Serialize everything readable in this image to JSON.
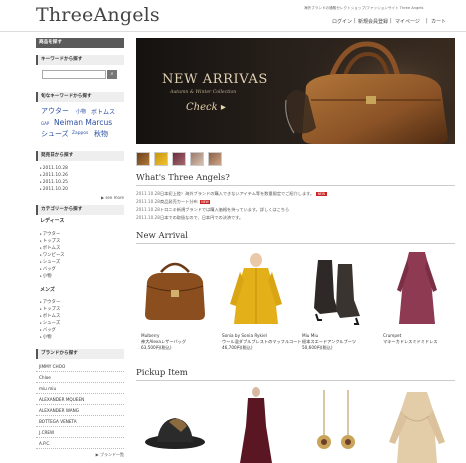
{
  "header": {
    "logo": "ThreeAngels",
    "tagline": "海外ブランドの通販セレクトショップ/ファッションサイト Three Angels",
    "nav": [
      "ログイン",
      "新規会員登録",
      "マイページ",
      "カート"
    ]
  },
  "sidebar": {
    "product_search_label": "商品を探す",
    "keyword_search_label": "キーワードから探す",
    "popular_keywords_label": "旬なキーワードから探す",
    "keywords": [
      "アウター",
      "小物",
      "ボトムス",
      "GAP",
      "Neiman Marcus",
      "シューズ",
      "Zappos",
      "秋物"
    ],
    "release_date_label": "発売日から探す",
    "release_dates": [
      "2011.10.28",
      "2011.10.26",
      "2011.10.25",
      "2011.10.20"
    ],
    "see_more": "▶ see more",
    "category_label": "カテゴリーから探す",
    "ladies_label": "レディース",
    "ladies_items": [
      "アウター",
      "トップス",
      "ボトムス",
      "ワンピース",
      "シューズ",
      "バッグ",
      "小物"
    ],
    "mens_label": "メンズ",
    "mens_items": [
      "アウター",
      "トップス",
      "ボトムス",
      "シューズ",
      "バッグ",
      "小物"
    ],
    "brand_label": "ブランドから探す",
    "brands": [
      "JIMMY CHOO",
      "Chloe",
      "miu miu",
      "ALEXANDER MQUEEN",
      "ALEXANDER WANG",
      "BOTTEGA VENETA",
      "J.CREW",
      "A.P.C."
    ],
    "brand_list_link": "▶ ブランド一覧"
  },
  "banner": {
    "title": "NEW ARRIVAS",
    "subtitle": "Autumn & Winter Collection",
    "cta": "Check ▸"
  },
  "about": {
    "title": "What's Three Angels?",
    "news": [
      {
        "date": "2011.10.28",
        "text": "日本初上陸！海外ブランドの購入できないアイテム等を数量限定でご紹介します。",
        "new": true
      },
      {
        "date": "2011.10.28",
        "text": "商品発売カート分布",
        "new": true
      },
      {
        "date": "2011.10.28",
        "text": "トロニキ新規ブランドでは購入価格を持っています。詳しくはこちら",
        "new": false
      },
      {
        "date": "2011.10.28",
        "text": "日本での取扱なので、日本円での決済です。",
        "new": false
      }
    ],
    "new_badge": "NEW"
  },
  "new_arrival": {
    "title": "New Arrival",
    "products": [
      {
        "brand": "Mulberry",
        "name": "神大Alexaレザーバッグ",
        "price": "63,500円(税込)"
      },
      {
        "brand": "Sonia by Sonia Rykiel",
        "name": "ウール混ダブルブレストのマッフルコート",
        "price": "46,700円(税込)"
      },
      {
        "brand": "Miu Miu",
        "name": "紐本スエードアンクルブーツ",
        "price": "50,600円(税込)"
      },
      {
        "brand": "Crumpet",
        "name": "マキーカドレスミドミドレス",
        "price": ""
      }
    ]
  },
  "pickup": {
    "title": "Pickup Item"
  },
  "colors": {
    "sidebar_head": "#5a5a5a",
    "link": "#2a4ea5",
    "badge": "#cc2222"
  }
}
